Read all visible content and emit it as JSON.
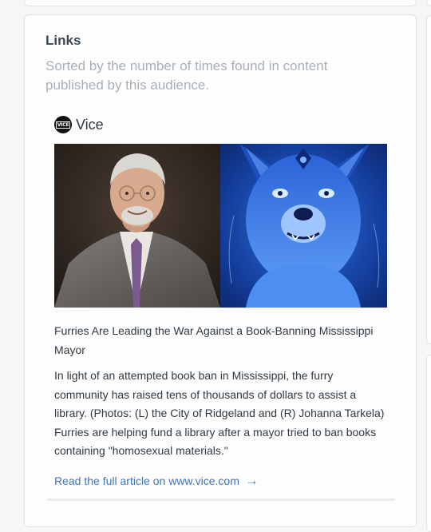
{
  "links_card": {
    "title": "Links",
    "subtitle": "Sorted by the number of times found in content published by this audience.",
    "item": {
      "source_name": "Vice",
      "source_logo_text": "VICE",
      "image_icon": "article-thumbnail-image",
      "title": "Furries Are Leading the War Against a Book-Banning Mississippi Mayor",
      "description": "In light of an attempted book ban in Mississippi, the furry community has raised tens of thousands of dollars to assist a library. (Photos: (L) the City of Ridgeland and (R) Johanna Tarkela) Furries are helping fund a library after a mayor tried to ban books containing \"homosexual materials.\"",
      "link_text": "Read the full article on www.vice.com",
      "link_icon": "arrow-right-icon"
    }
  },
  "colors": {
    "link": "#3f76b5",
    "title": "#3b4752",
    "muted": "#a9b0b7",
    "text": "#2f3a44"
  }
}
